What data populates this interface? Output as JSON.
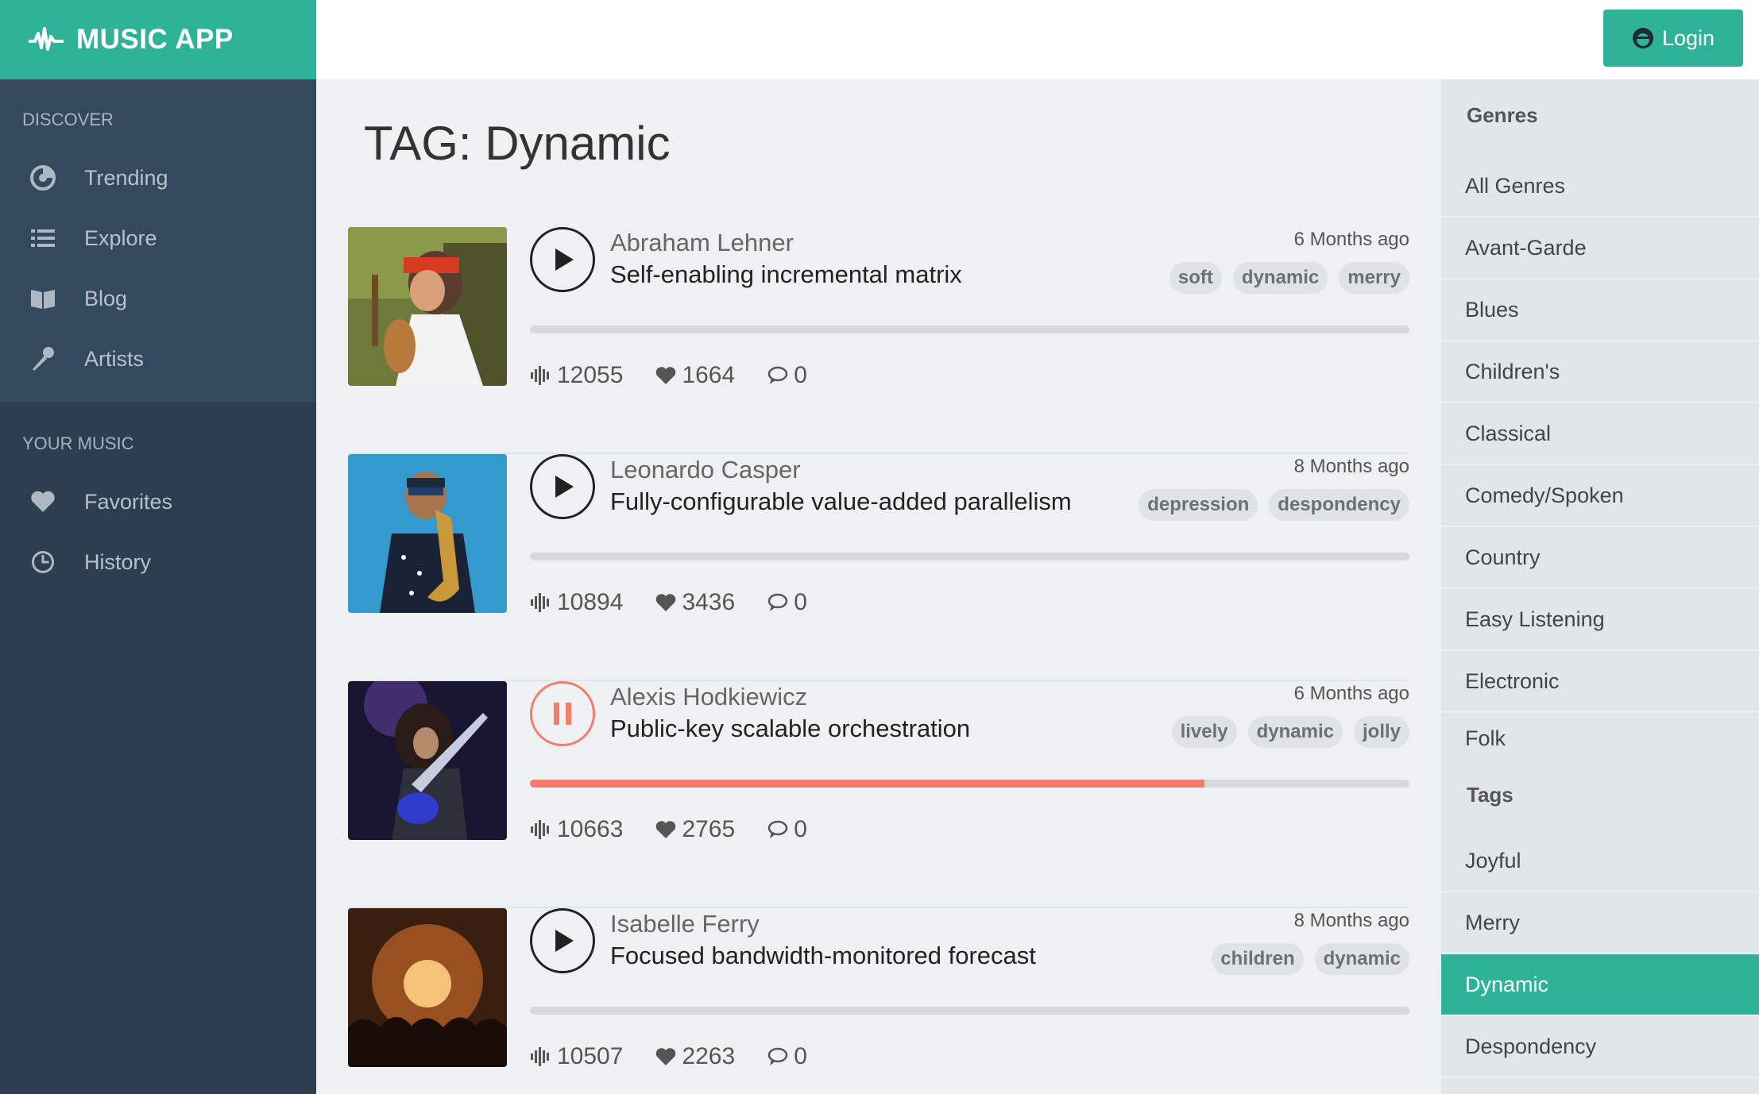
{
  "app": {
    "name": "MUSIC APP",
    "logo_icon": "waveform-icon"
  },
  "header": {
    "login_label": "Login",
    "login_icon": "user-avatar-icon"
  },
  "sidebar": {
    "discover_title": "DISCOVER",
    "discover_items": [
      {
        "label": "Trending",
        "icon": "trending-icon"
      },
      {
        "label": "Explore",
        "icon": "list-icon"
      },
      {
        "label": "Blog",
        "icon": "book-icon"
      },
      {
        "label": "Artists",
        "icon": "microphone-icon"
      }
    ],
    "yours_title": "YOUR MUSIC",
    "yours_items": [
      {
        "label": "Favorites",
        "icon": "heart-icon"
      },
      {
        "label": "History",
        "icon": "clock-icon"
      }
    ]
  },
  "main": {
    "title": "TAG: Dynamic",
    "tracks": [
      {
        "artist": "Abraham Lehner",
        "song": "Self-enabling incremental matrix",
        "ago": "6 Months ago",
        "tags": [
          "soft",
          "dynamic",
          "merry"
        ],
        "plays": "12055",
        "likes": "1664",
        "comments": "0",
        "playing": false,
        "progress": 0
      },
      {
        "artist": "Leonardo Casper",
        "song": "Fully-configurable value-added parallelism",
        "ago": "8 Months ago",
        "tags": [
          "depression",
          "despondency"
        ],
        "plays": "10894",
        "likes": "3436",
        "comments": "0",
        "playing": false,
        "progress": 0
      },
      {
        "artist": "Alexis Hodkiewicz",
        "song": "Public-key scalable orchestration",
        "ago": "6 Months ago",
        "tags": [
          "lively",
          "dynamic",
          "jolly"
        ],
        "plays": "10663",
        "likes": "2765",
        "comments": "0",
        "playing": true,
        "progress": 0.767
      },
      {
        "artist": "Isabelle Ferry",
        "song": "Focused bandwidth-monitored forecast",
        "ago": "8 Months ago",
        "tags": [
          "children",
          "dynamic"
        ],
        "plays": "10507",
        "likes": "2263",
        "comments": "0",
        "playing": false,
        "progress": 0
      }
    ]
  },
  "right": {
    "genres_title": "Genres",
    "genres": [
      "All Genres",
      "Avant-Garde",
      "Blues",
      "Children's",
      "Classical",
      "Comedy/Spoken",
      "Country",
      "Easy Listening",
      "Electronic",
      "Folk"
    ],
    "tags_title": "Tags",
    "tags": [
      "Joyful",
      "Merry",
      "Dynamic",
      "Despondency"
    ],
    "active_tag": "Dynamic"
  },
  "colors": {
    "accent": "#2eb398",
    "sidebar": "#2c3e50",
    "sidebar_top": "#34495e",
    "playing": "#f47c6b"
  }
}
